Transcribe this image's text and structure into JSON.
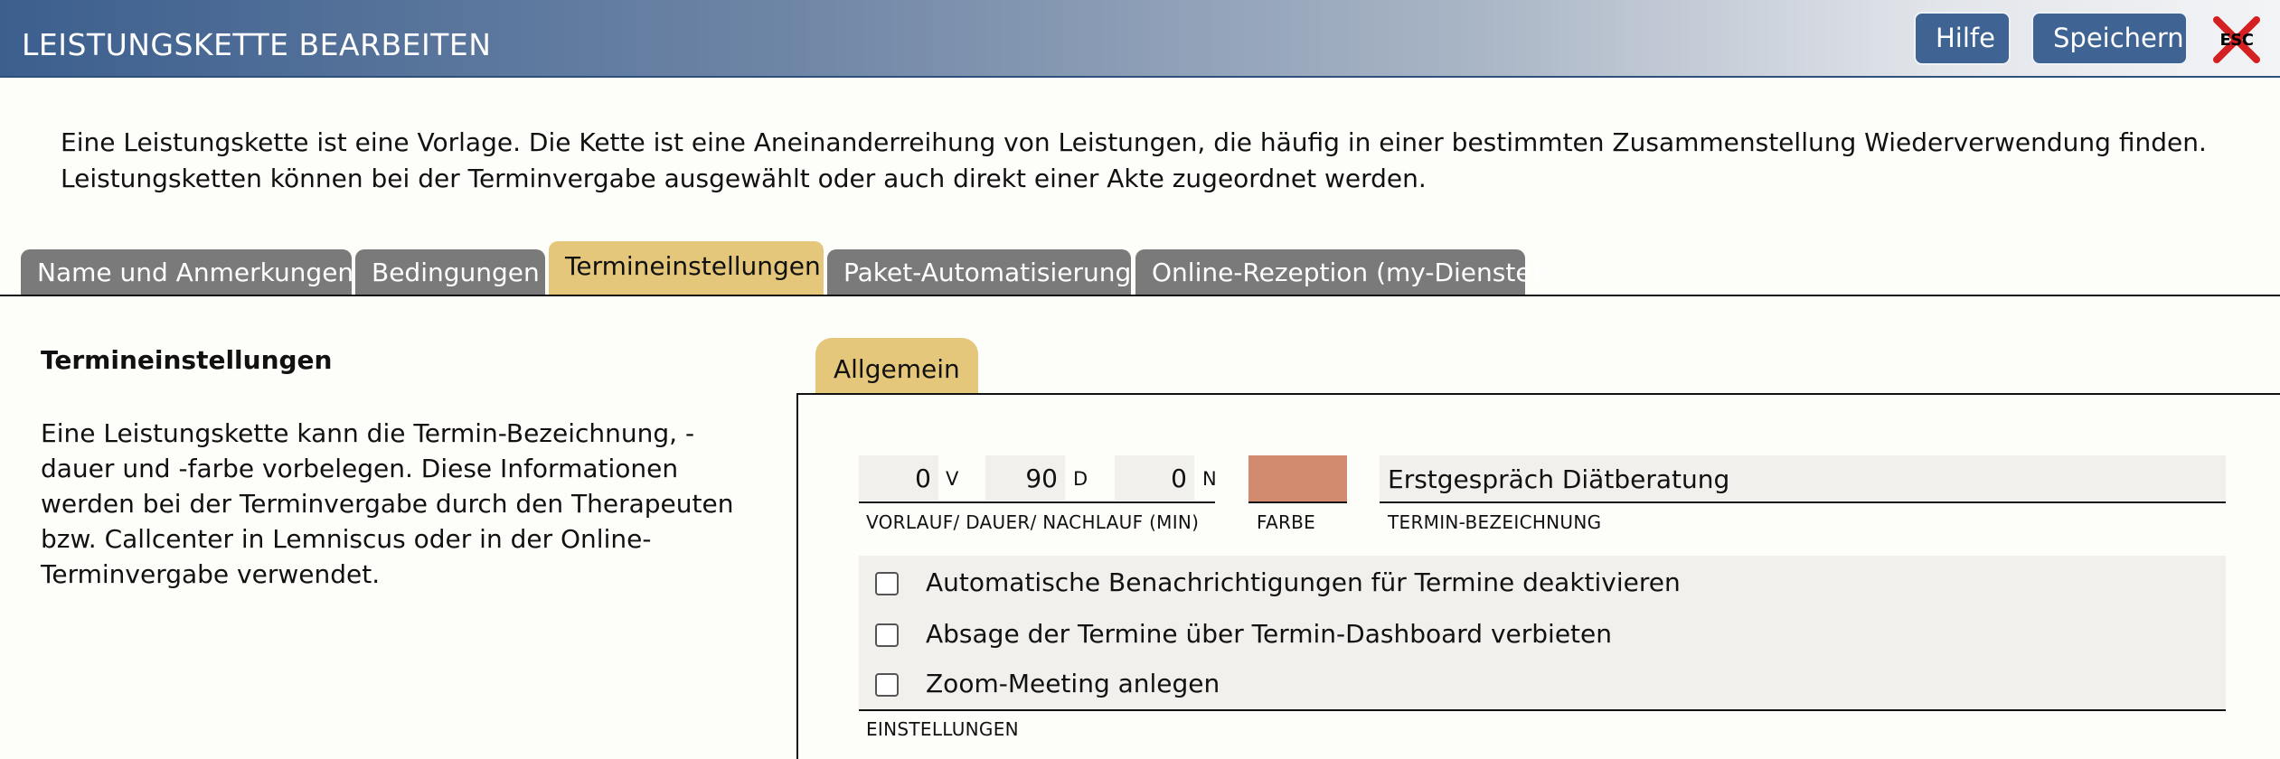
{
  "header": {
    "title": "LEISTUNGSKETTE BEARBEITEN",
    "help_label": "Hilfe",
    "save_label": "Speichern",
    "esc_label": "ESC"
  },
  "intro": "Eine Leistungskette ist eine Vorlage. Die Kette ist eine Aneinanderreihung von Leistungen, die häufig in einer bestimmten Zusammenstellung Wiederverwendung finden. Leistungsketten können bei der Terminvergabe ausgewählt oder auch direkt einer Akte zugeordnet werden.",
  "tabs": [
    {
      "label": "Name und Anmerkungen"
    },
    {
      "label": "Bedingungen"
    },
    {
      "label": "Termineinstellungen",
      "active": true
    },
    {
      "label": "Paket-Automatisierung"
    },
    {
      "label": "Online-Rezeption (my-Dienste)"
    }
  ],
  "left": {
    "heading": "Termineinstellungen",
    "text": "Eine Leistungskette kann die Termin-Bezeichnung, -dauer und -farbe vorbelegen. Diese Informationen werden bei der Terminvergabe durch den Therapeuten bzw. Callcenter in Lemniscus oder in der Online-Terminvergabe verwendet."
  },
  "subtab": {
    "label": "Allgemein"
  },
  "timing": {
    "vorlauf": "0",
    "vorlauf_unit": "V",
    "dauer": "90",
    "dauer_unit": "D",
    "nachlauf": "0",
    "nachlauf_unit": "N",
    "caption": "VORLAUF/ DAUER/ NACHLAUF (MIN)"
  },
  "color": {
    "caption": "FARBE",
    "value": "#d38b70"
  },
  "termin": {
    "value": "Erstgespräch Diätberatung",
    "caption": "TERMIN-BEZEICHNUNG"
  },
  "settings": {
    "items": [
      {
        "label": "Automatische Benachrichtigungen für Termine deaktivieren",
        "checked": false
      },
      {
        "label": "Absage der Termine über Termin-Dashboard verbieten",
        "checked": false
      },
      {
        "label": "Zoom-Meeting anlegen",
        "checked": false
      }
    ],
    "caption": "EINSTELLUNGEN"
  }
}
